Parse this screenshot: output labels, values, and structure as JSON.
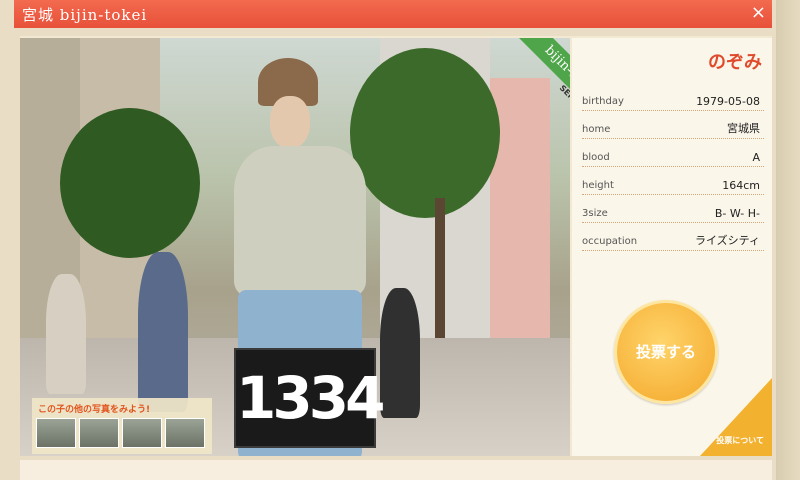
{
  "window": {
    "title": "宮城 bijin-tokei",
    "close_label": "×"
  },
  "badge": {
    "brand": "bijin-tokei",
    "city": "SENDAI"
  },
  "clock_sign": "1334",
  "thumbnails": {
    "label": "この子の他の写真をみよう!"
  },
  "profile": {
    "name": "のぞみ",
    "fields": [
      {
        "key": "birthday",
        "value": "1979-05-08"
      },
      {
        "key": "home",
        "value": "宮城県"
      },
      {
        "key": "blood",
        "value": "A"
      },
      {
        "key": "height",
        "value": "164cm"
      },
      {
        "key": "3size",
        "value": "B- W- H-"
      },
      {
        "key": "occupation",
        "value": "ライズシティ"
      }
    ]
  },
  "vote_label": "投票する",
  "corner_label": "投票について",
  "colors": {
    "accent": "#e8513a",
    "ribbon": "#4fa54a",
    "vote": "#f3a72a"
  }
}
